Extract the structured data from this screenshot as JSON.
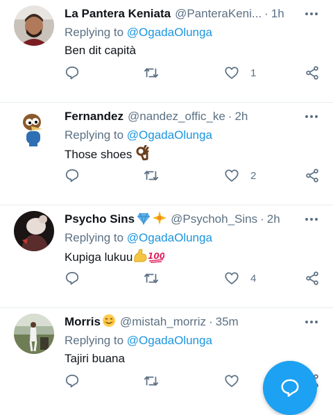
{
  "tweets": [
    {
      "name": "La Pantera Keniata",
      "handle": "@PanteraKeni...",
      "dot": "·",
      "time": "1h",
      "replying_label": "Replying to",
      "replying_to": "@OgadaOlunga",
      "text": "Ben dit capità",
      "likes": "1"
    },
    {
      "name": "Fernandez",
      "handle": "@nandez_offic_ke",
      "dot": "·",
      "time": "2h",
      "replying_label": "Replying to",
      "replying_to": "@OgadaOlunga",
      "text": "Those shoes",
      "likes": "2"
    },
    {
      "name": "Psycho Sins",
      "handle": "@Psychoh_Sins",
      "dot": "·",
      "time": "2h",
      "replying_label": "Replying to",
      "replying_to": "@OgadaOlunga",
      "text": "Kupiga lukuu",
      "likes": "4"
    },
    {
      "name": "Morris",
      "handle": "@mistah_morriz",
      "dot": "·",
      "time": "35m",
      "replying_label": "Replying to",
      "replying_to": "@OgadaOlunga",
      "text": "Tajiri buana",
      "likes": ""
    }
  ],
  "icons": {
    "reply": "reply-icon",
    "retweet": "retweet-icon",
    "like": "heart-icon",
    "share": "share-icon",
    "more": "more-icon",
    "compose": "compose-reply-icon"
  },
  "colors": {
    "accent": "#1da1f2",
    "mention": "#1b95e0",
    "secondary_text": "#5b7083"
  }
}
